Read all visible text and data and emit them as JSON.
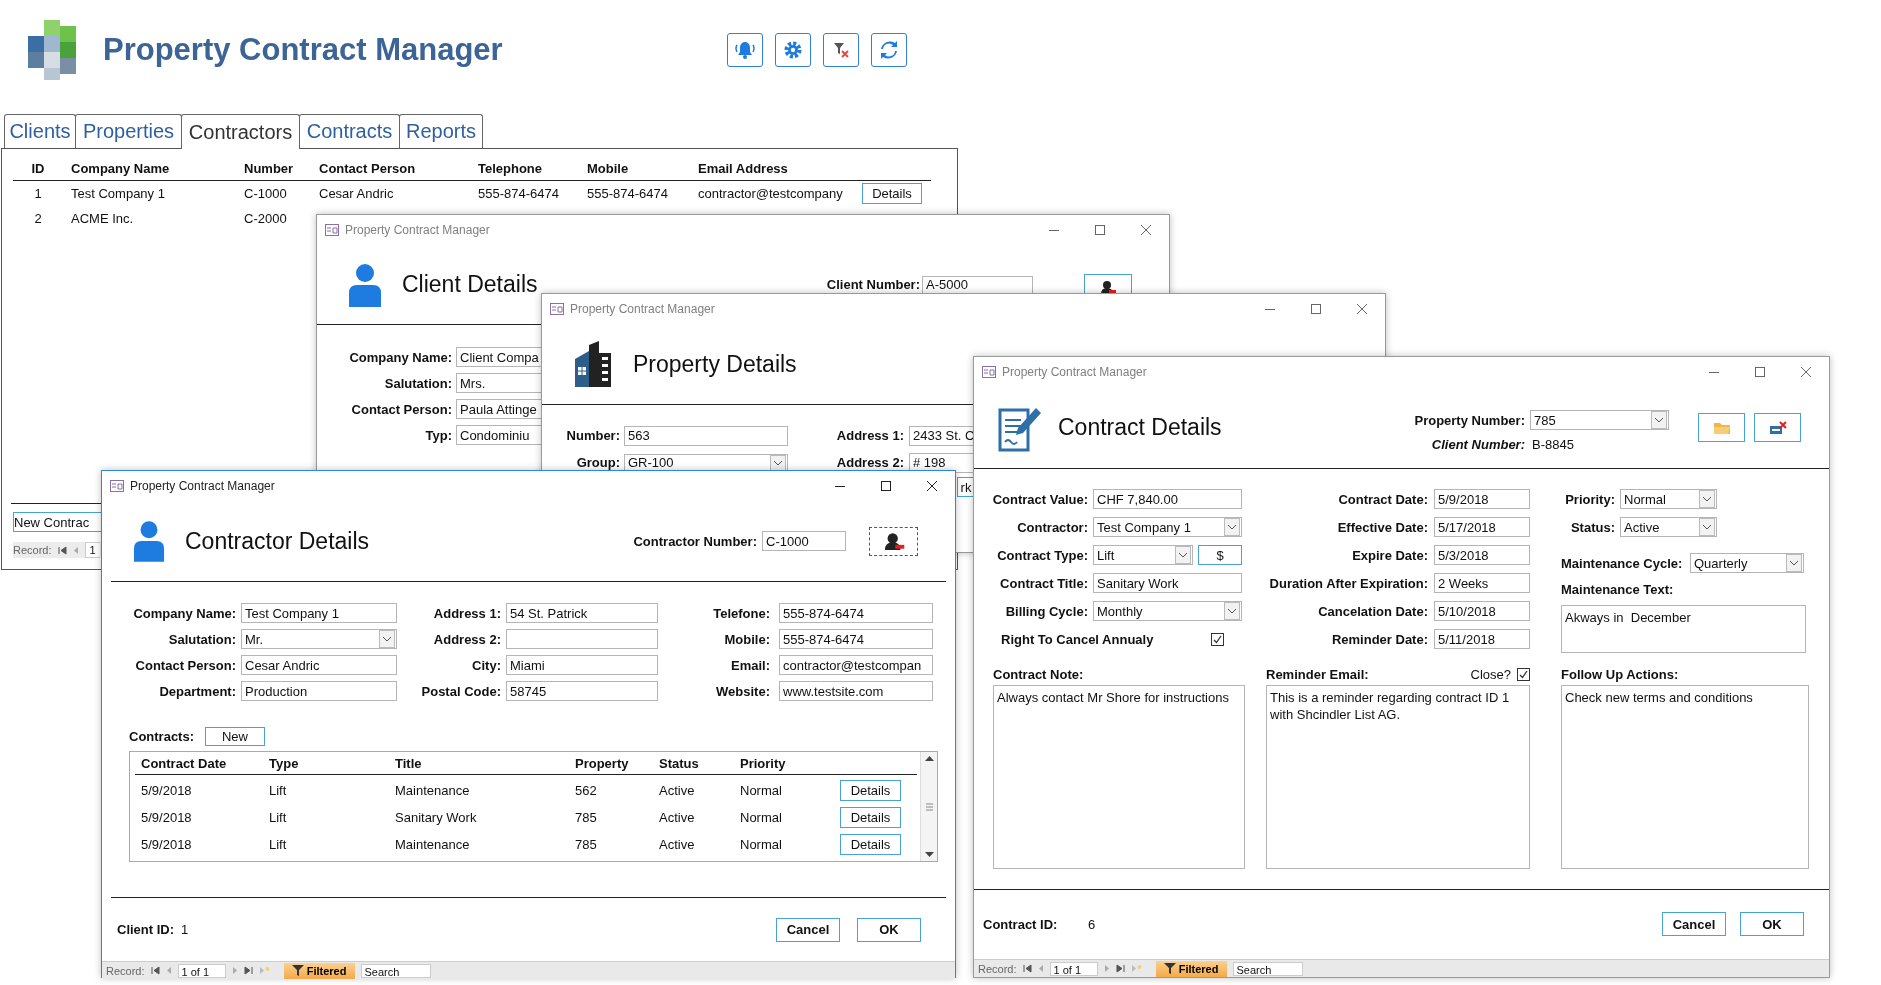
{
  "app": {
    "title": "Property Contract Manager"
  },
  "tabs": [
    {
      "label": "Clients",
      "selected": false
    },
    {
      "label": "Properties",
      "selected": false
    },
    {
      "label": "Contractors",
      "selected": true
    },
    {
      "label": "Contracts",
      "selected": false
    },
    {
      "label": "Reports",
      "selected": false
    }
  ],
  "contractors_table": {
    "columns": [
      "ID",
      "Company Name",
      "Number",
      "Contact Person",
      "Telephone",
      "Mobile",
      "Email Address"
    ],
    "rows": [
      {
        "cells": [
          "1",
          "Test Company 1",
          "C-1000",
          "Cesar Andric",
          "555-874-6474",
          "555-874-6474",
          "contractor@testcompany"
        ],
        "button": "Details"
      },
      {
        "cells": [
          "2",
          "ACME Inc.",
          "C-2000"
        ]
      }
    ]
  },
  "main_footer": {
    "new_button": "New Contrac",
    "record_label": "Record:",
    "record_value": "1"
  },
  "client_window": {
    "title": "Property Contract Manager",
    "active": false,
    "heading": "Client Details",
    "number_label": "Client Number:",
    "number": "A-5000",
    "fields": [
      {
        "label": "Company Name:",
        "value": "Client Compa"
      },
      {
        "label": "Salutation:",
        "value": "Mrs."
      },
      {
        "label": "Contact Person:",
        "value": "Paula Attinge"
      },
      {
        "label": "Typ:",
        "value": "Condominiu"
      }
    ]
  },
  "property_window": {
    "title": "Property Contract Manager",
    "active": false,
    "heading": "Property Details",
    "left_fields": [
      {
        "label": "Number:",
        "value": "563",
        "kind": "text"
      },
      {
        "label": "Group:",
        "value": "GR-100",
        "kind": "dropdown"
      }
    ],
    "right_fields": [
      {
        "label": "Address 1:",
        "value": "2433 St. C",
        "kind": "text"
      },
      {
        "label": "Address 2:",
        "value": "# 198",
        "kind": "text"
      }
    ],
    "partial_button": "rk"
  },
  "contractor_window": {
    "title": "Property Contract Manager",
    "active": true,
    "heading": "Contractor Details",
    "number_label": "Contractor Number:",
    "number": "C-1000",
    "columns": [
      [
        {
          "label": "Company Name:",
          "value": "Test Company 1",
          "kind": "text"
        },
        {
          "label": "Salutation:",
          "value": "Mr.",
          "kind": "dropdown"
        },
        {
          "label": "Contact Person:",
          "value": "Cesar Andric",
          "kind": "text"
        },
        {
          "label": "Department:",
          "value": "Production",
          "kind": "text"
        }
      ],
      [
        {
          "label": "Address 1:",
          "value": "54 St. Patrick",
          "kind": "text"
        },
        {
          "label": "Address 2:",
          "kind": "text"
        },
        {
          "label": "City:",
          "value": "Miami",
          "kind": "text"
        },
        {
          "label": "Postal Code:",
          "value": "58745",
          "kind": "text"
        }
      ],
      [
        {
          "label": "Telefone:",
          "value": "555-874-6474",
          "kind": "text"
        },
        {
          "label": "Mobile:",
          "value": "555-874-6474",
          "kind": "text"
        },
        {
          "label": "Email:",
          "value": "contractor@testcompan",
          "kind": "text"
        },
        {
          "label": "Website:",
          "value": "www.testsite.com",
          "kind": "text"
        }
      ]
    ],
    "contracts_label": "Contracts:",
    "new_button": "New",
    "table": {
      "columns": [
        "Contract Date",
        "Type",
        "Title",
        "Property",
        "Status",
        "Priority"
      ],
      "rows": [
        {
          "cells": [
            "5/9/2018",
            "Lift",
            "Maintenance",
            "562",
            "Active",
            "Normal"
          ],
          "button": "Details"
        },
        {
          "cells": [
            "5/9/2018",
            "Lift",
            "Sanitary Work",
            "785",
            "Active",
            "Normal"
          ],
          "button": "Details"
        },
        {
          "cells": [
            "5/9/2018",
            "Lift",
            "Maintenance",
            "785",
            "Active",
            "Normal"
          ],
          "button": "Details"
        }
      ]
    },
    "client_id_label": "Client ID:",
    "client_id": "1",
    "buttons": [
      "Cancel",
      "OK"
    ],
    "record_bar": {
      "label": "Record:",
      "position": "1 of 1",
      "filter": "Filtered",
      "search": "Search"
    }
  },
  "contract_window": {
    "title": "Property Contract Manager",
    "active": false,
    "heading": "Contract Details",
    "property_number": {
      "label": "Property Number:",
      "value": "785"
    },
    "client_number": {
      "label": "Client Number:",
      "value": "B-8845"
    },
    "left_fields": [
      {
        "label": "Contract Value:",
        "value": "CHF 7,840.00",
        "kind": "text"
      },
      {
        "label": "Contractor:",
        "value": "Test Company 1",
        "kind": "dropdown"
      },
      {
        "label": "Contract Type:",
        "value": "Lift",
        "kind": "dropdown_button",
        "button": "$"
      },
      {
        "label": "Contract Title:",
        "value": "Sanitary Work",
        "kind": "text"
      },
      {
        "label": "Billing Cycle:",
        "value": "Monthly",
        "kind": "dropdown"
      }
    ],
    "cancel_annually": {
      "label": "Right To Cancel Annualy",
      "checked": true
    },
    "date_fields": [
      {
        "label": "Contract Date:",
        "value": "5/9/2018"
      },
      {
        "label": "Effective Date:",
        "value": "5/17/2018"
      },
      {
        "label": "Expire Date:",
        "value": "5/3/2018"
      },
      {
        "label": "Duration After Expiration:",
        "value": "2 Weeks"
      },
      {
        "label": "Cancelation Date:",
        "value": "5/10/2018"
      },
      {
        "label": "Reminder Date:",
        "value": "5/11/2018"
      }
    ],
    "status_fields": [
      {
        "label": "Priority:",
        "value": "Normal"
      },
      {
        "label": "Status:",
        "value": "Active"
      }
    ],
    "maintenance_cycle": {
      "label": "Maintenance Cycle:",
      "value": "Quarterly"
    },
    "maintenance_text": {
      "label": "Maintenance Text:",
      "value": "Akways in  December"
    },
    "contract_note": {
      "label": "Contract Note:",
      "value": "Always contact Mr Shore for instructions"
    },
    "reminder_email": {
      "label": "Reminder Email:",
      "value": "This is a reminder regarding contract ID 1 with Shcindler List AG.",
      "close_label": "Close?",
      "close_checked": true
    },
    "follow_up": {
      "label": "Follow Up Actions:",
      "value": "Check new terms and conditions"
    },
    "contract_id_label": "Contract ID:",
    "contract_id": "6",
    "buttons": [
      "Cancel",
      "OK"
    ],
    "record_bar": {
      "label": "Record:",
      "position": "1 of 1",
      "filter": "Filtered",
      "search": "Search"
    }
  }
}
